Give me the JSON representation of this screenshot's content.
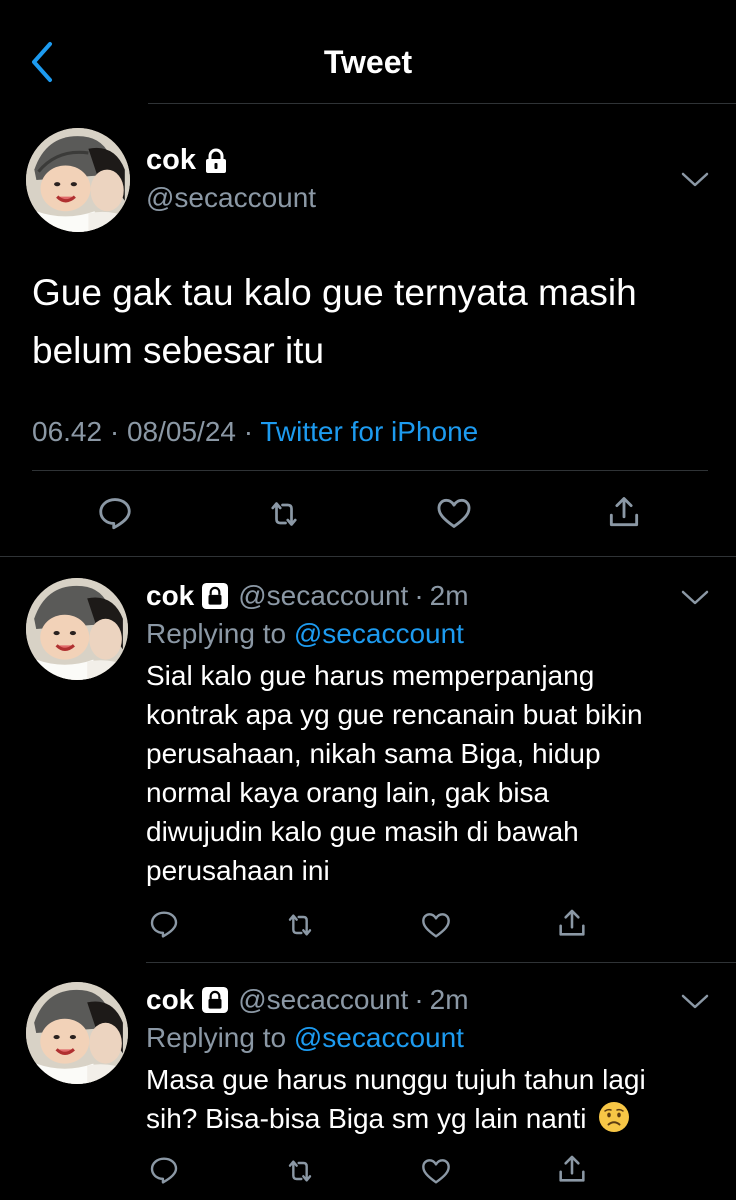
{
  "header": {
    "title": "Tweet"
  },
  "main_tweet": {
    "name": "cok",
    "handle": "@secaccount",
    "text_line1": "Gue gak tau kalo gue ternyata masih",
    "text_line2": "belum sebesar itu",
    "time": "06.42",
    "date": "08/05/24",
    "source": "Twitter for iPhone",
    "sep": "·"
  },
  "replies": [
    {
      "name": "cok",
      "handle": "@secaccount",
      "time": "2m",
      "replying_label": "Replying to",
      "replying_to": "@secaccount",
      "lines": [
        "Sial kalo gue harus memperpanjang",
        "kontrak apa yg gue rencanain buat bikin",
        "perusahaan, nikah sama Biga, hidup",
        "normal kaya orang lain, gak bisa",
        "diwujudin kalo gue masih di bawah",
        "perusahaan ini"
      ]
    },
    {
      "name": "cok",
      "handle": "@secaccount",
      "time": "2m",
      "replying_label": "Replying to",
      "replying_to": "@secaccount",
      "lines": [
        "Masa gue harus nunggu tujuh tahun lagi",
        "sih? Bisa-bisa Biga sm yg lain nanti"
      ],
      "emoji": "worried-face"
    }
  ],
  "icons": {
    "back": "chevron-left-icon",
    "more": "chevron-down-icon",
    "lock": "lock-icon",
    "reply": "reply-icon",
    "retweet": "retweet-icon",
    "like": "heart-icon",
    "share": "share-icon"
  },
  "colors": {
    "accent": "#1d9bf0",
    "background": "#000000",
    "secondary_text": "#8b98a5"
  }
}
